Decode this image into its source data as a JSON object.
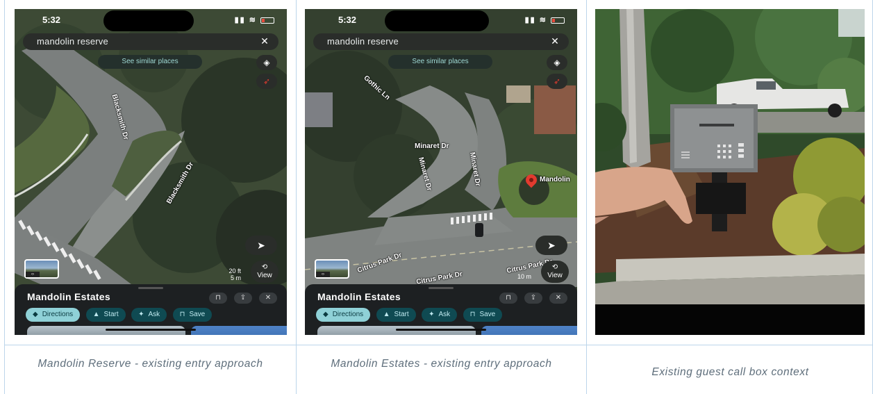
{
  "panels": [
    {
      "caption": "Mandolin Reserve - existing entry approach",
      "status_time": "5:32",
      "search_query": "mandolin reserve",
      "similar_label": "See similar places",
      "place_name": "Mandolin Estates",
      "streets": [
        "Blacksmith Dr",
        "Blacksmith Dr"
      ],
      "scale": [
        "20 ft",
        "5 m"
      ],
      "view_label": "View",
      "chips": [
        "Directions",
        "Start",
        "Ask",
        "Save"
      ]
    },
    {
      "caption": "Mandolin Estates - existing entry approach",
      "status_time": "5:32",
      "search_query": "mandolin reserve",
      "similar_label": "See similar places",
      "place_name": "Mandolin Estates",
      "streets": [
        "Gothic Ln",
        "Minaret Dr",
        "Minaret Dr",
        "Minaret Dr",
        "Citrus Park Dr",
        "Citrus Park Dr",
        "Citrus Park Dr"
      ],
      "pin_label": "Mandolin",
      "scale": [
        "10 m"
      ],
      "view_label": "View",
      "chips": [
        "Directions",
        "Start",
        "Ask",
        "Save"
      ]
    },
    {
      "caption": "Existing guest call box context"
    }
  ],
  "icons": {
    "close": "close-icon",
    "layers": "layers-icon",
    "compass": "compass-icon",
    "navigate": "navigate-arrow-icon",
    "view360": "view-360-icon",
    "bookmark": "bookmark-icon",
    "share": "share-icon"
  },
  "colors": {
    "border": "#bcd5ea",
    "caption": "#5e6e7b",
    "chip_primary": "#8fd1d7",
    "chip": "#0f4a52",
    "pin": "#e23b2f"
  }
}
